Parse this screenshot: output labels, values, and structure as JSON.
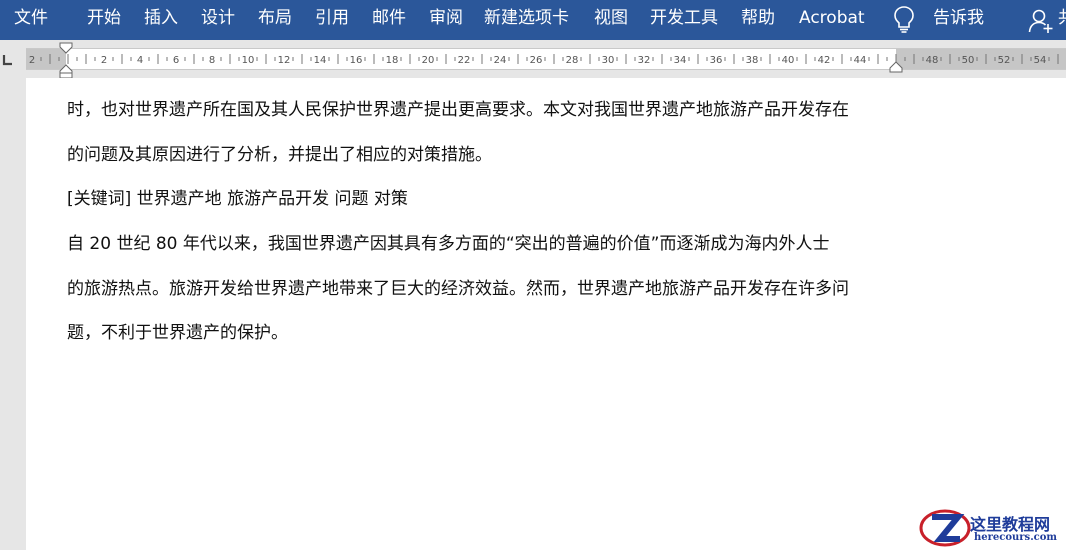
{
  "ribbon": {
    "tabs": [
      {
        "label": "文件"
      },
      {
        "label": "开始"
      },
      {
        "label": "插入"
      },
      {
        "label": "设计"
      },
      {
        "label": "布局"
      },
      {
        "label": "引用"
      },
      {
        "label": "邮件"
      },
      {
        "label": "审阅"
      },
      {
        "label": "新建选项卡"
      },
      {
        "label": "视图"
      },
      {
        "label": "开发工具"
      },
      {
        "label": "帮助"
      },
      {
        "label": "Acrobat"
      }
    ],
    "tell_me_label": "告诉我",
    "share_cut_label": "共",
    "tell_me_icon": "lightbulb-icon",
    "user_icon": "add-user-icon",
    "color": "#2b579a"
  },
  "ruler": {
    "numbers": [
      "2",
      "2",
      "4",
      "6",
      "8",
      "10",
      "12",
      "14",
      "16",
      "18",
      "20",
      "22",
      "24",
      "26",
      "28",
      "30",
      "32",
      "34",
      "36",
      "38",
      "40",
      "42",
      "44",
      "48",
      "50",
      "52",
      "54"
    ],
    "tab_selector_icon": "left-tab-stop-icon"
  },
  "document": {
    "paragraphs": [
      "时，也对世界遗产所在国及其人民保护世界遗产提出更高要求。本文对我国世界遗产地旅游产品开发存在",
      "的问题及其原因进行了分析，并提出了相应的对策措施。",
      "[关键词]  世界遗产地    旅游产品开发    问题    对策",
      "自 20 世纪 80 年代以来，我国世界遗产因其具有多方面的“突出的普遍的价值”而逐渐成为海内外人士",
      "的旅游热点。旅游开发给世界遗产地带来了巨大的经济效益。然而，世界遗产地旅游产品开发存在许多问",
      "题，不利于世界遗产的保护。"
    ]
  },
  "watermark": {
    "title": "这里教程网",
    "url": "herecours.com",
    "logo_icon": "z-logo-icon"
  }
}
